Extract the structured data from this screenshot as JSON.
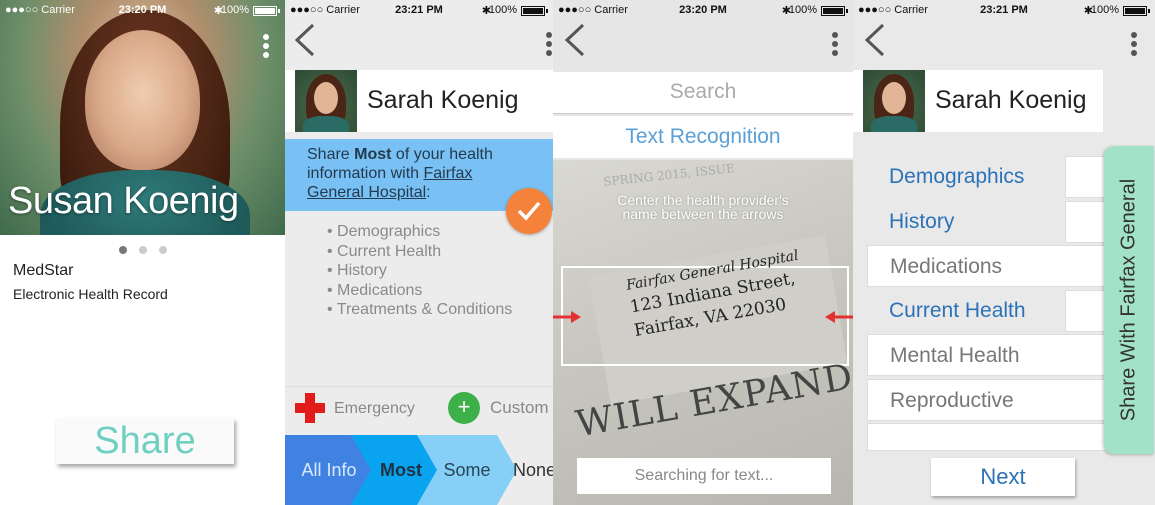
{
  "status_bars": [
    {
      "carrier": "●●●○○ Carrier",
      "time": "23:20 PM",
      "battery": "100%"
    },
    {
      "carrier": "●●●○○ Carrier",
      "time": "23:21 PM",
      "battery": "100%"
    },
    {
      "carrier": "●●●○○ Carrier",
      "time": "23:20 PM",
      "battery": "100%"
    },
    {
      "carrier": "●●●○○ Carrier",
      "time": "23:21 PM",
      "battery": "100%"
    }
  ],
  "screen1": {
    "name": "Susan Koenig",
    "org": "MedStar",
    "record_type": "Electronic Health Record",
    "share_label": "Share"
  },
  "screen2": {
    "profile_name": "Sarah Koenig",
    "banner_prefix": "Share ",
    "banner_level": "Most",
    "banner_mid": " of your health information with ",
    "banner_hospital": "Fairfax General Hospital",
    "banner_suffix": ":",
    "items": [
      "Demographics",
      "Current Health",
      "History",
      "Medications",
      "Treatments & Conditions"
    ],
    "emergency_label": "Emergency",
    "plus_label": "+",
    "custom_label": "Custom",
    "levels": [
      "All Info",
      "Most",
      "Some",
      "None"
    ],
    "selected_level": "Most"
  },
  "screen3": {
    "search_placeholder": "Search",
    "ocr_tab": "Text Recognition",
    "instruction_line1": "Center the health provider's",
    "instruction_line2": "name between the arrows",
    "address_line1": "Fairfax General Hospital",
    "address_line2": "123 Indiana Street,",
    "address_line3": "Fairfax, VA 22030",
    "background_print": "WILL EXPAND CARE",
    "background_faint": "SPRING 2015, ISSUE",
    "status": "Searching for text..."
  },
  "screen4": {
    "profile_name": "Sarah Koenig",
    "categories": [
      {
        "label": "Demographics",
        "selected": true
      },
      {
        "label": "History",
        "selected": true
      },
      {
        "label": "Medications",
        "selected": false
      },
      {
        "label": "Current Health",
        "selected": true
      },
      {
        "label": "Mental Health",
        "selected": false
      },
      {
        "label": "Reproductive",
        "selected": false
      }
    ],
    "side_tab": "Share With Fairfax General",
    "next_label": "Next"
  },
  "colors": {
    "teal_accent": "#6fcfc0",
    "banner_blue": "#79c1f4",
    "check_orange": "#f4823b",
    "link_blue": "#2b72b8",
    "side_tab_mint": "#a2e2c9",
    "emergency_red": "#e21b1b",
    "plus_green": "#3db04a"
  }
}
